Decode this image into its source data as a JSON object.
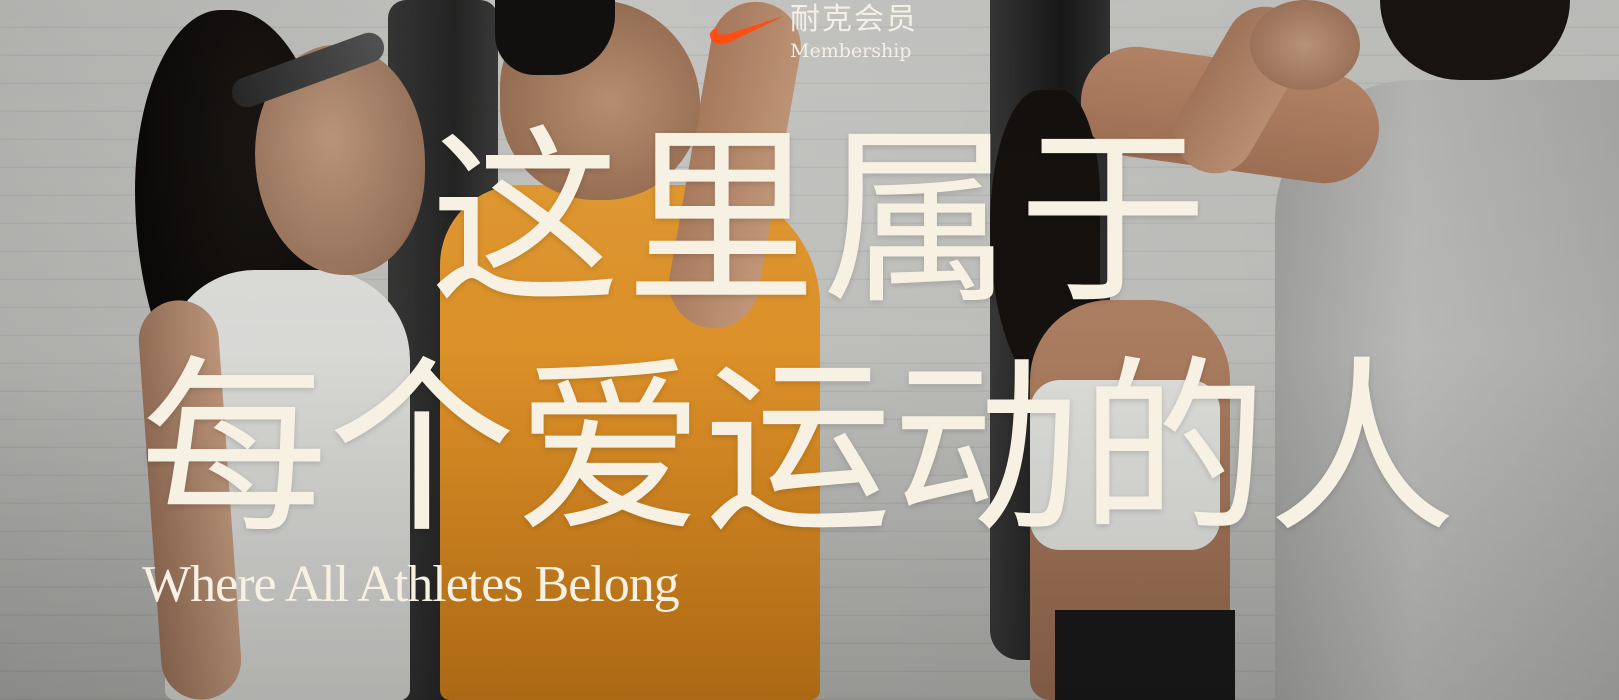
{
  "brand": {
    "name_zh": "耐克会员",
    "name_en": "Membership",
    "swoosh_color": "#ff4d14",
    "text_color": "#f5f0e6"
  },
  "hero": {
    "headline_line1": "这里属于",
    "headline_line2": "每个爱运动的人",
    "tagline": "Where All Athletes Belong",
    "text_color": "#f7f1e3",
    "icon": "swoosh-icon"
  }
}
